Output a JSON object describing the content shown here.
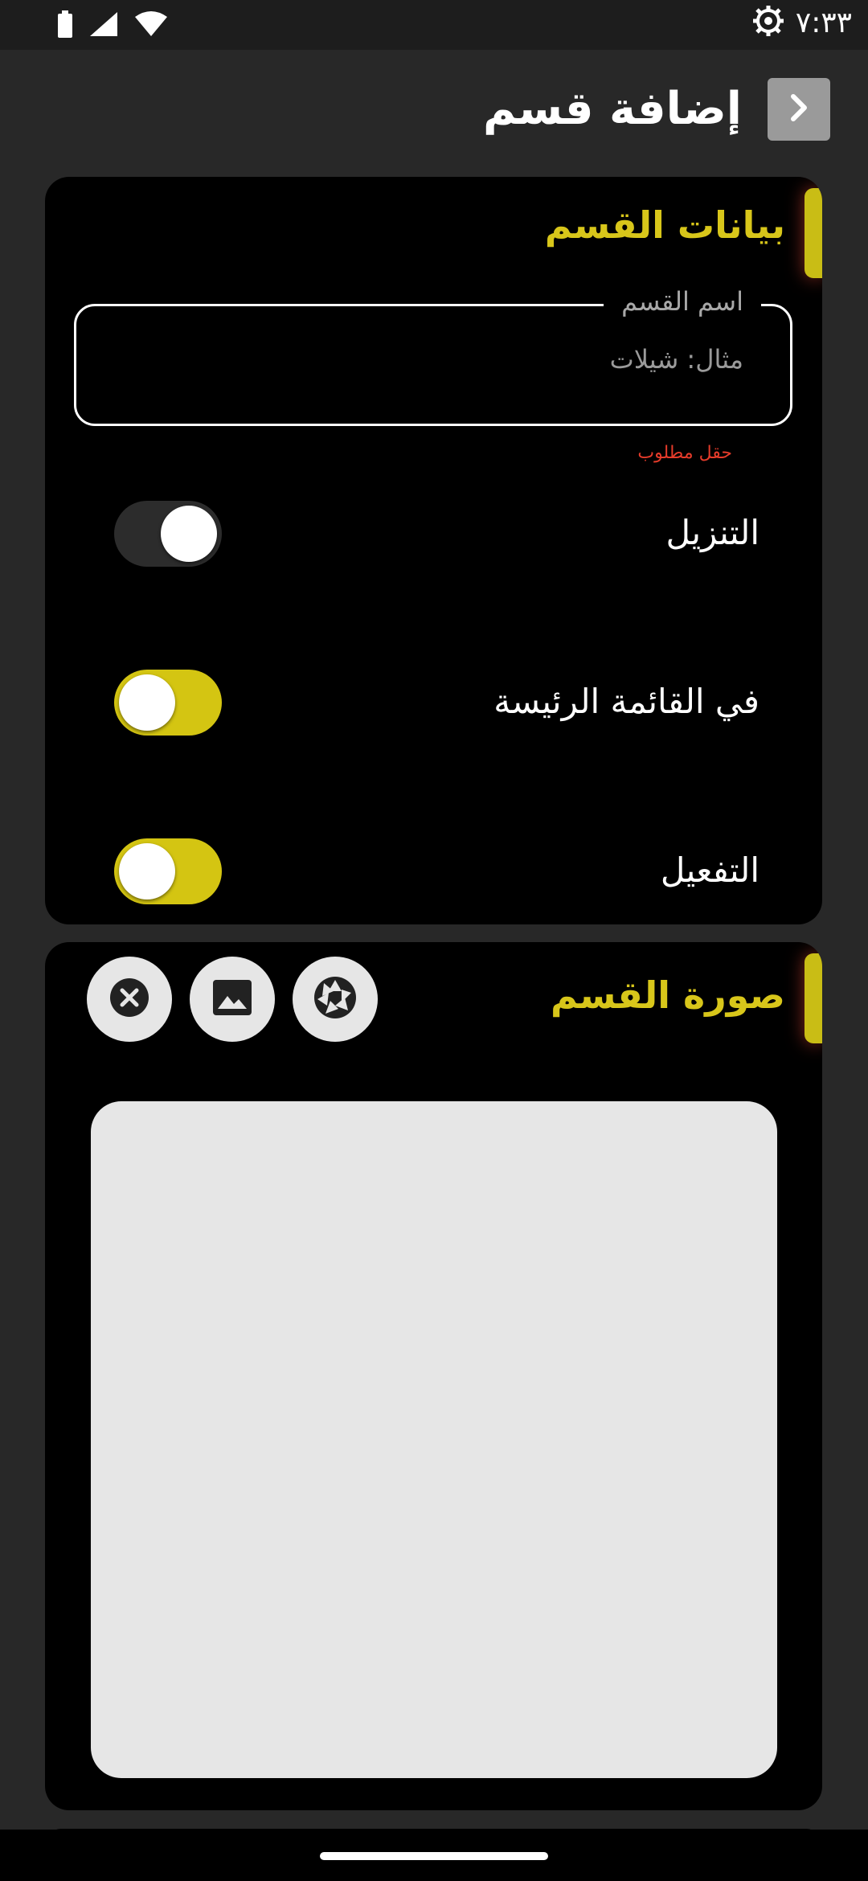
{
  "status_bar": {
    "time": "٧:٣٣",
    "icons": [
      "battery-icon",
      "signal-icon",
      "wifi-icon",
      "settings-icon"
    ]
  },
  "app_bar": {
    "title": "إضافة قسم",
    "back_icon": "chevron-right-icon"
  },
  "section_data": {
    "title": "بيانات القسم",
    "name_field": {
      "label": "اسم القسم",
      "placeholder": "مثال: شيلات",
      "value": "",
      "error": "حقل مطلوب"
    },
    "toggles": [
      {
        "label": "التنزيل",
        "state": "off"
      },
      {
        "label": "في القائمة الرئيسة",
        "state": "on"
      },
      {
        "label": "التفعيل",
        "state": "on"
      }
    ]
  },
  "section_image": {
    "title": "صورة القسم",
    "buttons": [
      "camera-icon",
      "gallery-icon",
      "clear-icon"
    ]
  },
  "colors": {
    "accent": "#d8c61a",
    "background": "#282828",
    "card": "#000000",
    "error": "#e53b2a"
  }
}
